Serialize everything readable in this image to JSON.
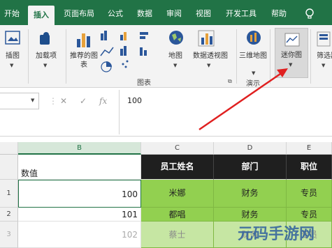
{
  "tabs": [
    {
      "label": "开始",
      "active": false
    },
    {
      "label": "插入",
      "active": true
    },
    {
      "label": "页面布局",
      "active": false
    },
    {
      "label": "公式",
      "active": false
    },
    {
      "label": "数据",
      "active": false
    },
    {
      "label": "审阅",
      "active": false
    },
    {
      "label": "视图",
      "active": false
    },
    {
      "label": "开发工具",
      "active": false
    },
    {
      "label": "帮助",
      "active": false
    }
  ],
  "ribbon": {
    "illustrations": "插图",
    "addins": "加载项",
    "recommended_charts": "推荐的图表",
    "map": "地图",
    "pivot_chart": "数据透视图",
    "map3d": "三维地图",
    "charts_group": "图表",
    "tours_group": "演示",
    "sparklines": "迷你图",
    "filter": "筛选器",
    "accent_color": "#217346"
  },
  "formula_bar": {
    "name_box": "",
    "cancel_icon": "close-icon",
    "enter_icon": "check-icon",
    "fx_label": "fx",
    "value": "100"
  },
  "columns": [
    "B",
    "C",
    "D",
    "E"
  ],
  "rows": [
    "1",
    "2",
    "3"
  ],
  "table": {
    "header_b": "数值",
    "headers": [
      "员工姓名",
      "部门",
      "职位"
    ],
    "data": [
      {
        "value": "100",
        "name": "米娜",
        "dept": "财务",
        "pos": "专员"
      },
      {
        "value": "101",
        "name": "都唱",
        "dept": "财务",
        "pos": "专员"
      },
      {
        "value": "102",
        "name": "蔡士",
        "dept": "财务",
        "pos": "专员"
      }
    ]
  },
  "watermark": "元码手游网"
}
